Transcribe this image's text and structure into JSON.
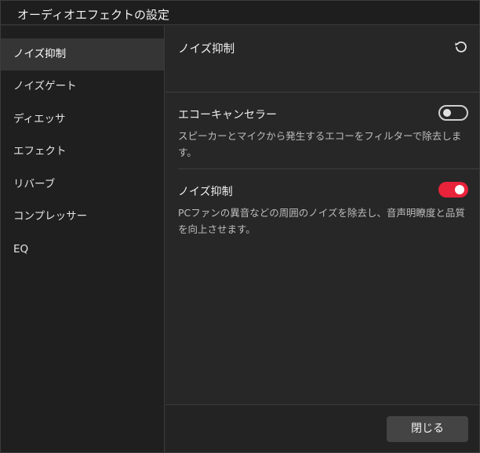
{
  "window": {
    "title": "オーディオエフェクトの設定"
  },
  "sidebar": {
    "items": [
      {
        "label": "ノイズ抑制",
        "active": true
      },
      {
        "label": "ノイズゲート",
        "active": false
      },
      {
        "label": "ディエッサ",
        "active": false
      },
      {
        "label": "エフェクト",
        "active": false
      },
      {
        "label": "リバーブ",
        "active": false
      },
      {
        "label": "コンプレッサー",
        "active": false
      },
      {
        "label": "EQ",
        "active": false
      }
    ]
  },
  "main": {
    "section_title": "ノイズ抑制",
    "reset_icon": "reset-icon",
    "settings": [
      {
        "label": "エコーキャンセラー",
        "description": "スピーカーとマイクから発生するエコーをフィルターで除去します。",
        "enabled": false
      },
      {
        "label": "ノイズ抑制",
        "description": "PCファンの異音などの周囲のノイズを除去し、音声明瞭度と品質を向上させます。",
        "enabled": true
      }
    ]
  },
  "footer": {
    "close_label": "閉じる"
  },
  "colors": {
    "accent": "#e8233a",
    "background": "#272727",
    "sidebar": "#1f1f1f",
    "sidebar_active": "#353535"
  }
}
